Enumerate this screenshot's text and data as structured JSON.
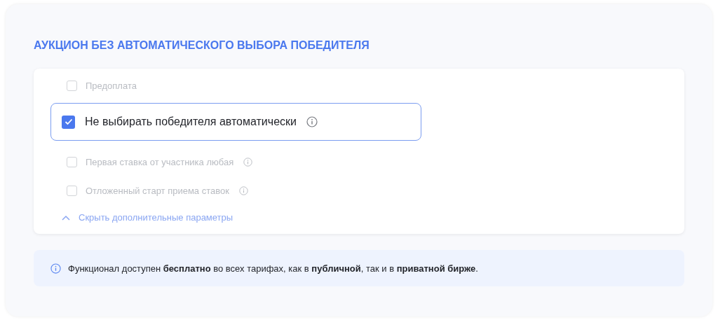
{
  "title": "АУКЦИОН БЕЗ АВТОМАТИЧЕСКОГО ВЫБОРА ПОБЕДИТЕЛЯ",
  "options": [
    {
      "label": "Предоплата",
      "checked": false,
      "disabled": true,
      "info": false
    },
    {
      "label": "Не выбирать победителя автоматически",
      "checked": true,
      "disabled": false,
      "info": true
    },
    {
      "label": "Первая ставка от участника любая",
      "checked": false,
      "disabled": true,
      "info": true
    },
    {
      "label": "Отложенный старт приема ставок",
      "checked": false,
      "disabled": true,
      "info": true
    }
  ],
  "toggle": {
    "label": "Скрыть дополнительные параметры",
    "expanded": true
  },
  "notice": "Функционал доступен **бесплатно** во всех тарифах, как в **публичной**, так и в **приватной бирже**."
}
